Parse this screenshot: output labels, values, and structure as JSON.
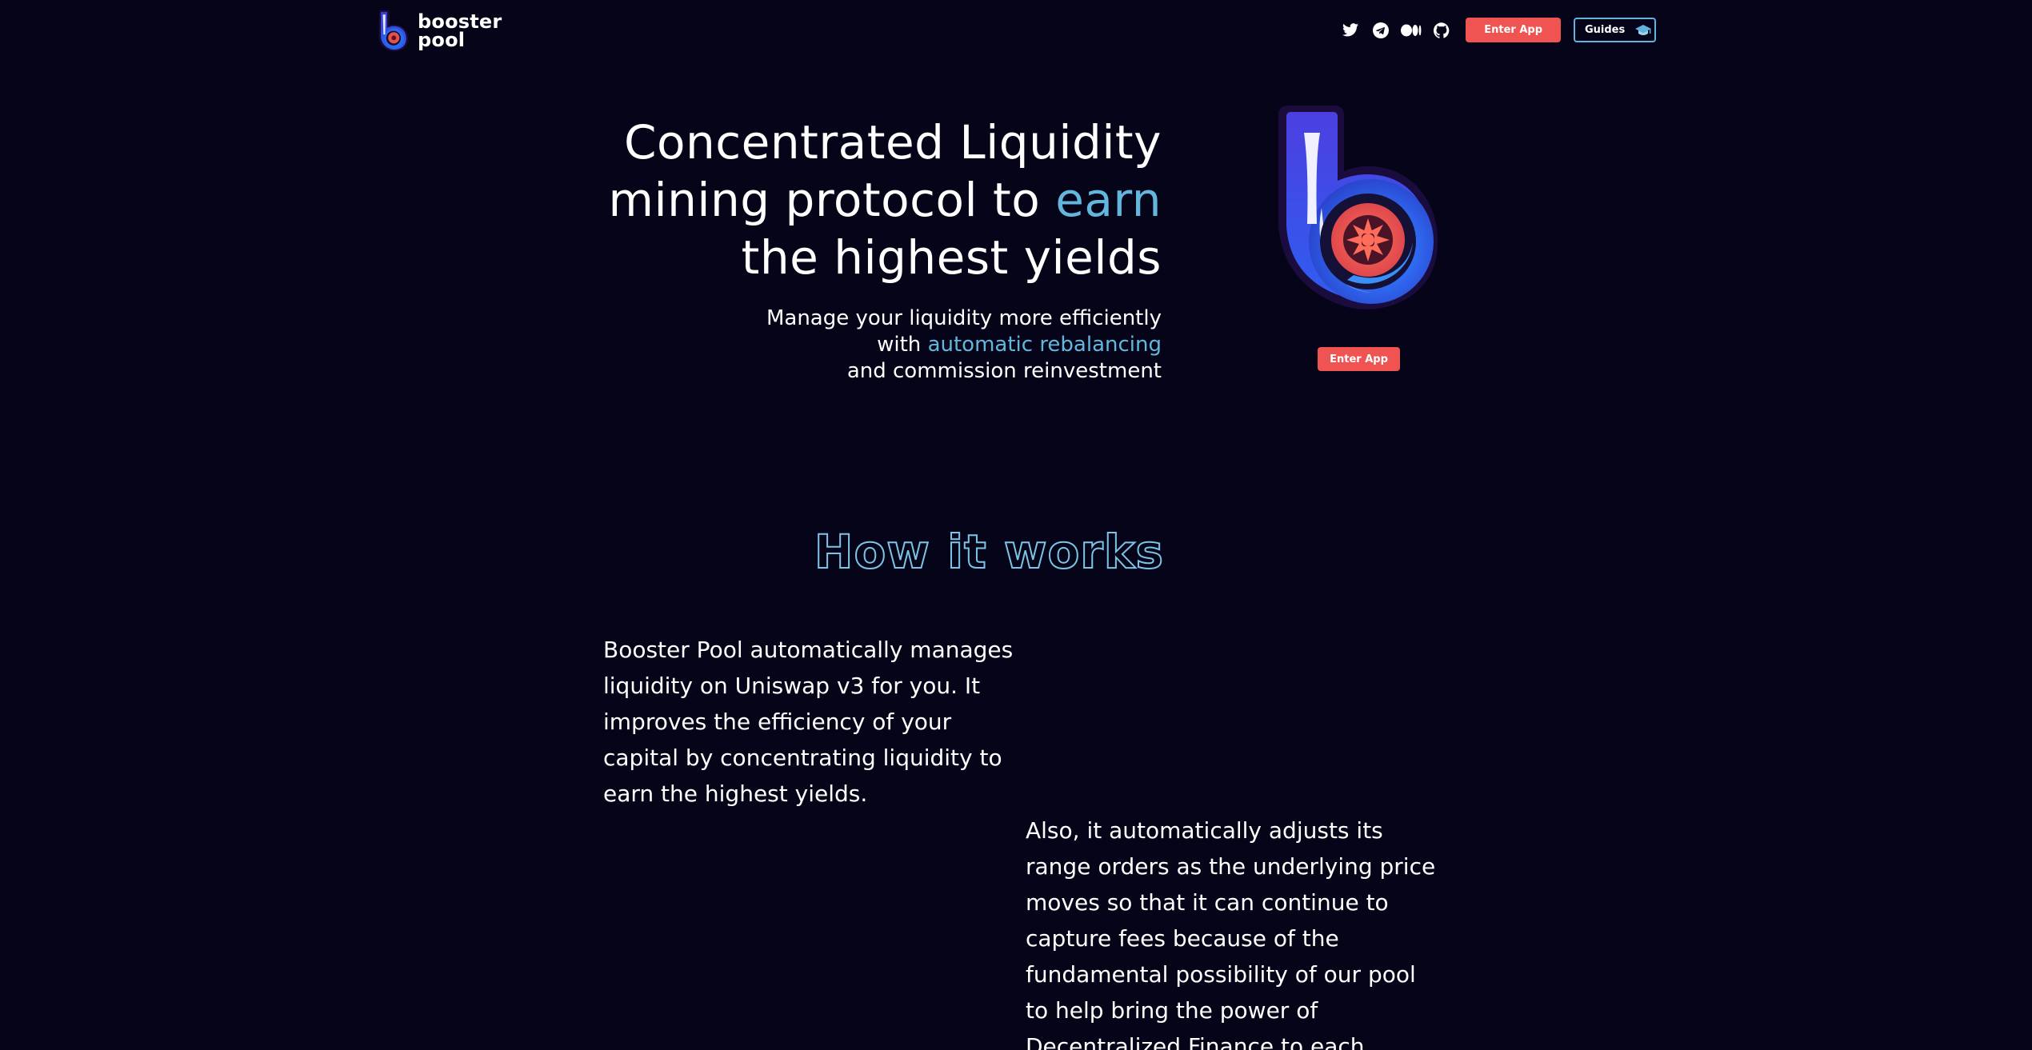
{
  "header": {
    "logo_text_line1": "booster",
    "logo_text_line2": "pool",
    "social": [
      "twitter-icon",
      "telegram-icon",
      "medium-icon",
      "github-icon"
    ],
    "enter_app_label": "Enter App",
    "guides_label": "Guides"
  },
  "hero": {
    "title_line1": "Concentrated Liquidity",
    "title_line2_pre": "mining protocol to ",
    "title_line2_accent": "earn",
    "title_line3": "the highest yields",
    "sub_line1": "Manage your liquidity more efficiently",
    "sub_line2_pre": "with ",
    "sub_line2_accent": "automatic rebalancing",
    "sub_line3": "and commission reinvestment",
    "cta_label": "Enter App"
  },
  "how_it_works": {
    "title": "How it works",
    "paragraph1": "Booster Pool automatically manages liquidity on Uniswap v3 for you. It improves the efficiency of your capital by concentrating liquidity to earn the highest yields.",
    "paragraph2": "Also, it automatically adjusts its range orders as the underlying price moves so that it can continue to capture fees because of the fundamental possibility of our pool to help bring the power of Decentralized Finance to each"
  },
  "colors": {
    "background": "#050419",
    "accent": "#63b7dd",
    "cta": "#ef5453"
  }
}
